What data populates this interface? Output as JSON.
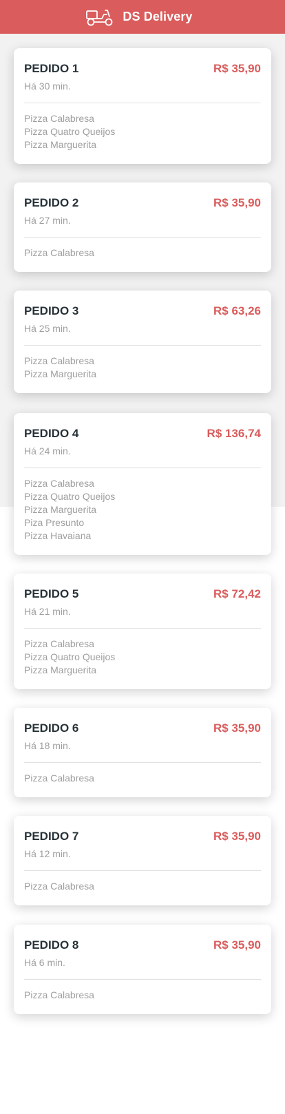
{
  "header": {
    "title": "DS Delivery",
    "icon": "motorcycle-icon",
    "bg_color": "#da5c5c"
  },
  "orders": [
    {
      "title": "PEDIDO 1",
      "price": "R$ 35,90",
      "time": "Há 30 min.",
      "items": [
        "Pizza Calabresa",
        "Pizza Quatro Queijos",
        "Pizza Marguerita"
      ]
    },
    {
      "title": "PEDIDO 2",
      "price": "R$ 35,90",
      "time": "Há 27 min.",
      "items": [
        "Pizza Calabresa"
      ]
    },
    {
      "title": "PEDIDO 3",
      "price": "R$ 63,26",
      "time": "Há 25 min.",
      "items": [
        "Pizza Calabresa",
        "Pizza Marguerita"
      ]
    },
    {
      "title": "PEDIDO 4",
      "price": "R$ 136,74",
      "time": "Há 24 min.",
      "items": [
        "Pizza Calabresa",
        "Pizza Quatro Queijos",
        "Pizza Marguerita",
        "Piza Presunto",
        "Pizza Havaiana"
      ]
    },
    {
      "title": "PEDIDO 5",
      "price": "R$ 72,42",
      "time": "Há 21 min.",
      "items": [
        "Pizza Calabresa",
        "Pizza Quatro Queijos",
        "Pizza Marguerita"
      ]
    },
    {
      "title": "PEDIDO 6",
      "price": "R$ 35,90",
      "time": "Há 18 min.",
      "items": [
        "Pizza Calabresa"
      ]
    },
    {
      "title": "PEDIDO 7",
      "price": "R$ 35,90",
      "time": "Há 12 min.",
      "items": [
        "Pizza Calabresa"
      ]
    },
    {
      "title": "PEDIDO 8",
      "price": "R$ 35,90",
      "time": "Há 6 min.",
      "items": [
        "Pizza Calabresa"
      ]
    }
  ],
  "colors": {
    "accent": "#da5c5c",
    "title_text": "#263238",
    "muted_text": "#9e9e9e"
  }
}
